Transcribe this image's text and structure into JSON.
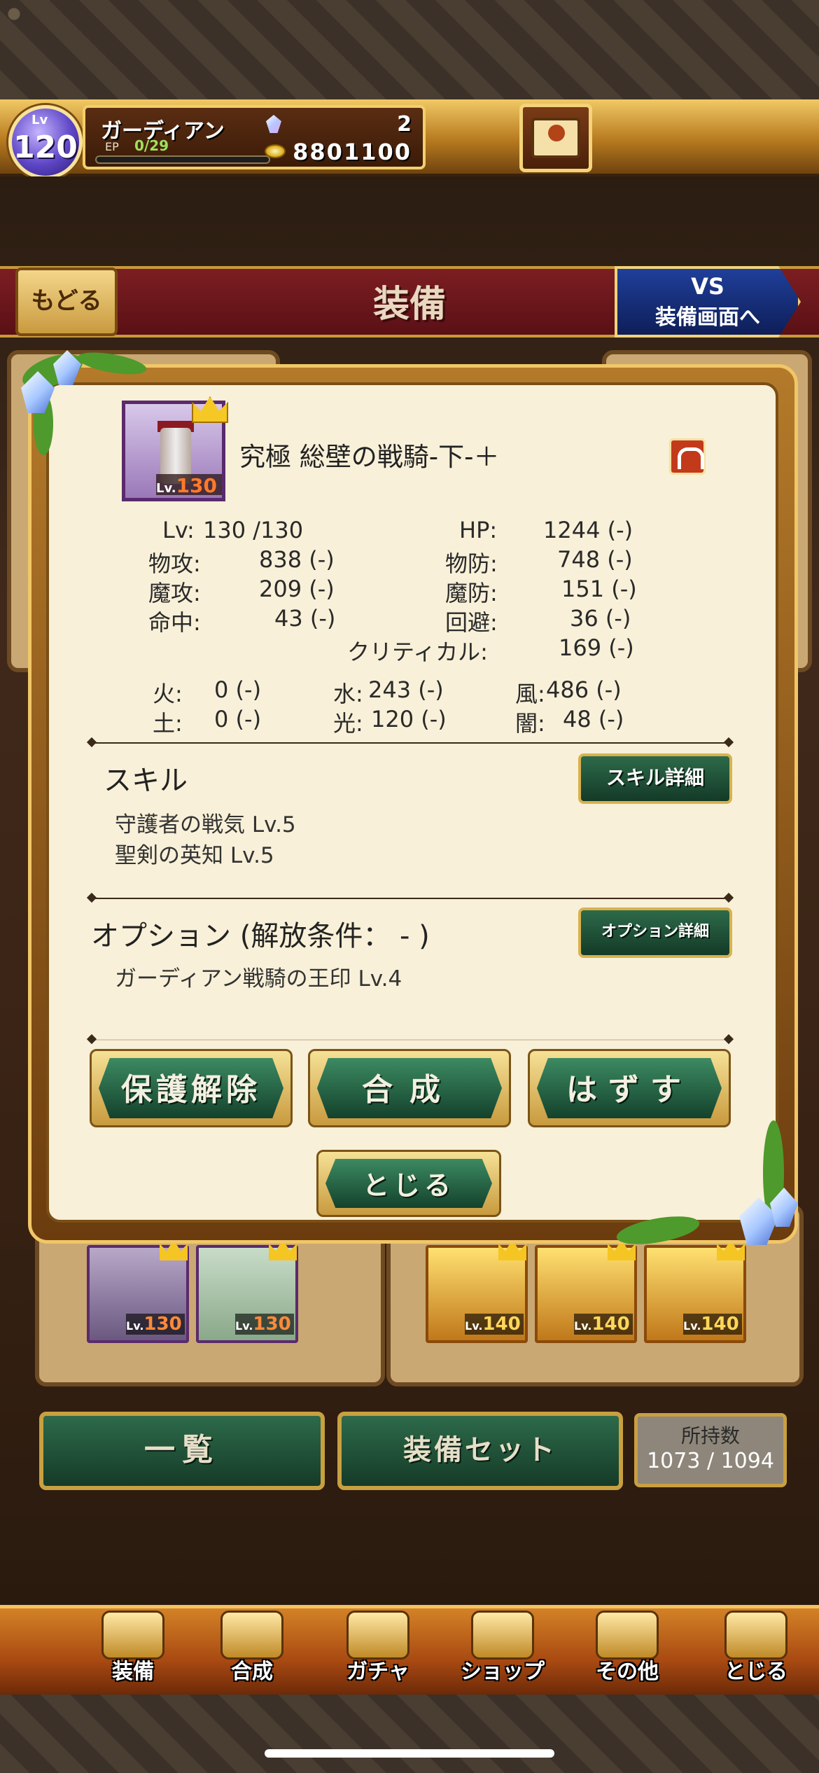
{
  "status": {
    "level_prefix": "Lv",
    "level": "120",
    "player_name": "ガーディアン",
    "ep_label": "EP",
    "ep_value": "0/29",
    "gems": "2",
    "coins": "8801100"
  },
  "header": {
    "back_label": "もどる",
    "title": "装備",
    "vs_line1": "VS",
    "vs_line2": "装備画面へ"
  },
  "background": {
    "card_lv_prefix": "Lv.",
    "cards": [
      {
        "lv": "130",
        "tier": "purple"
      },
      {
        "lv": "130",
        "tier": "purple"
      },
      {
        "lv": "140",
        "tier": "gold"
      },
      {
        "lv": "140",
        "tier": "gold"
      },
      {
        "lv": "140",
        "tier": "gold"
      }
    ],
    "list_button": "一覧",
    "set_button": "装備セット",
    "count_label": "所持数",
    "count_value": "1073 / 1094"
  },
  "dialog": {
    "item": {
      "lv_prefix": "Lv.",
      "lv": "130",
      "name": "究極 総壁の戦騎-下-＋"
    },
    "stats": {
      "lv_label": "Lv:",
      "lv_value": "130 /130",
      "hp_label": "HP:",
      "hp_value": "1244 (-)",
      "patk_label": "物攻:",
      "patk_value": "838 (-)",
      "pdef_label": "物防:",
      "pdef_value": "748 (-)",
      "matk_label": "魔攻:",
      "matk_value": "209 (-)",
      "mdef_label": "魔防:",
      "mdef_value": "151 (-)",
      "hit_label": "命中:",
      "hit_value": "43 (-)",
      "eva_label": "回避:",
      "eva_value": "36 (-)",
      "crit_label": "クリティカル:",
      "crit_value": "169 (-)"
    },
    "elements": {
      "fire_label": "火:",
      "fire_value": "0 (-)",
      "water_label": "水:",
      "water_value": "243 (-)",
      "wind_label": "風:",
      "wind_value": "486 (-)",
      "earth_label": "土:",
      "earth_value": "0 (-)",
      "light_label": "光:",
      "light_value": "120 (-)",
      "dark_label": "闇:",
      "dark_value": "48 (-)"
    },
    "skill_title": "スキル",
    "skill_detail_button": "スキル詳細",
    "skills": [
      "守護者の戦気  Lv.5",
      "聖剣の英知  Lv.5"
    ],
    "option_title": "オプション (解放条件： - )",
    "option_detail_button": "オプション詳細",
    "option_text": "ガーディアン戦騎の王印 Lv.4",
    "buttons": {
      "unprotect": "保護解除",
      "synthesize": "合成",
      "remove": "はずす",
      "close": "とじる"
    }
  },
  "nav": {
    "items": [
      "装備",
      "合成",
      "ガチャ",
      "ショップ",
      "その他",
      "とじる"
    ]
  }
}
